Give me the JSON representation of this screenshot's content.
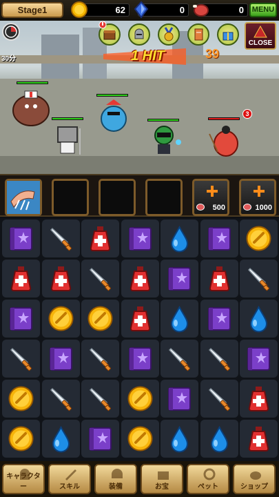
{
  "top": {
    "stage": "Stage1",
    "gold": "62",
    "gems": "0",
    "meat": "0",
    "menu": "MENU"
  },
  "scene": {
    "timer": "30分",
    "hit_text": "1 HIT",
    "combo": "39",
    "close": "CLOSE",
    "enemy_count": "3",
    "heroes": [
      {
        "name": "ogre-hero",
        "hp": 1.0
      },
      {
        "name": "blue-knight-hero",
        "hp": 1.0
      },
      {
        "name": "bucket-knight-hero",
        "hp": 1.0
      },
      {
        "name": "helmet-hero",
        "hp": 1.0
      }
    ],
    "enemy": {
      "name": "red-imp-enemy",
      "hp": 1.0
    }
  },
  "slots": [
    {
      "type": "skill",
      "cost": ""
    },
    {
      "type": "empty",
      "cost": ""
    },
    {
      "type": "empty",
      "cost": ""
    },
    {
      "type": "empty",
      "cost": ""
    },
    {
      "type": "buy",
      "cost": "500"
    },
    {
      "type": "buy",
      "cost": "1000"
    }
  ],
  "board": [
    [
      "book",
      "sword",
      "potion",
      "book",
      "drop",
      "book",
      "coin"
    ],
    [
      "potion",
      "potion",
      "sword",
      "potion",
      "book",
      "potion",
      "sword"
    ],
    [
      "book",
      "coin",
      "coin",
      "potion",
      "drop",
      "book",
      "drop"
    ],
    [
      "sword",
      "book",
      "sword",
      "book",
      "sword",
      "sword",
      "book"
    ],
    [
      "coin",
      "sword",
      "sword",
      "coin",
      "book",
      "sword",
      "potion"
    ],
    [
      "coin",
      "drop",
      "book",
      "coin",
      "drop",
      "drop",
      "potion"
    ]
  ],
  "nav": [
    {
      "label": "キャラクター",
      "icon": "knight-icon"
    },
    {
      "label": "スキル",
      "icon": "sword-icon"
    },
    {
      "label": "装備",
      "icon": "helmet-icon"
    },
    {
      "label": "お宝",
      "icon": "chest-icon"
    },
    {
      "label": "ペット",
      "icon": "collar-icon"
    },
    {
      "label": "ショップ",
      "icon": "pot-icon"
    }
  ]
}
